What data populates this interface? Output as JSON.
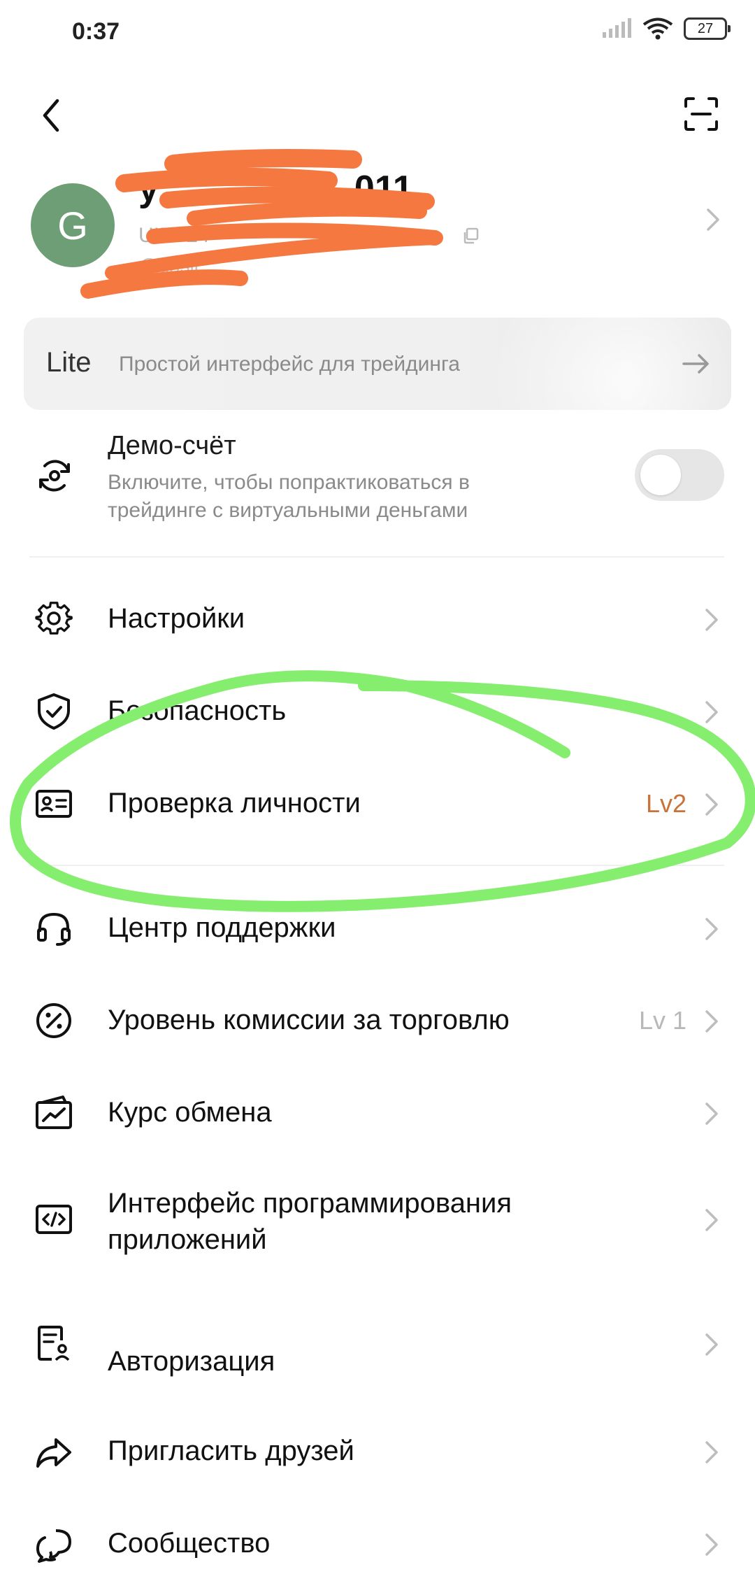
{
  "status_bar": {
    "time": "0:37",
    "battery": "27"
  },
  "profile": {
    "avatar_letter": "G",
    "name": "y",
    "name_tail": "011",
    "uid_label": "UID: 24",
    "handle": "@grisli"
  },
  "lite": {
    "tag": "Lite",
    "description": "Простой интерфейс для трейдинга"
  },
  "demo": {
    "title": "Демо-счёт",
    "description": "Включите, чтобы попрактиковаться в трейдинге с виртуальными деньгами",
    "enabled": false
  },
  "menu": [
    {
      "label": "Настройки",
      "icon": "gear-icon"
    },
    {
      "label": "Безопасность",
      "icon": "shield-check-icon"
    },
    {
      "label": "Проверка личности",
      "icon": "id-card-icon",
      "badge": "Lv2",
      "badge_color": "#c8733a"
    },
    {
      "label": "Центр поддержки",
      "icon": "headset-icon"
    },
    {
      "label": "Уровень комиссии за торговлю",
      "icon": "percent-icon",
      "badge": "Lv 1",
      "badge_color": "#b8b8b8"
    },
    {
      "label": "Курс обмена",
      "icon": "exchange-chart-icon"
    },
    {
      "label": "Интерфейс программирования приложений",
      "icon": "code-icon"
    },
    {
      "label": "Авторизация",
      "icon": "document-user-icon"
    },
    {
      "label": "Пригласить друзей",
      "icon": "share-arrow-icon"
    },
    {
      "label": "Сообщество",
      "icon": "chat-bubbles-icon"
    }
  ],
  "annotations": {
    "redaction_color": "#f47840",
    "highlight_color": "#86ee6e"
  }
}
